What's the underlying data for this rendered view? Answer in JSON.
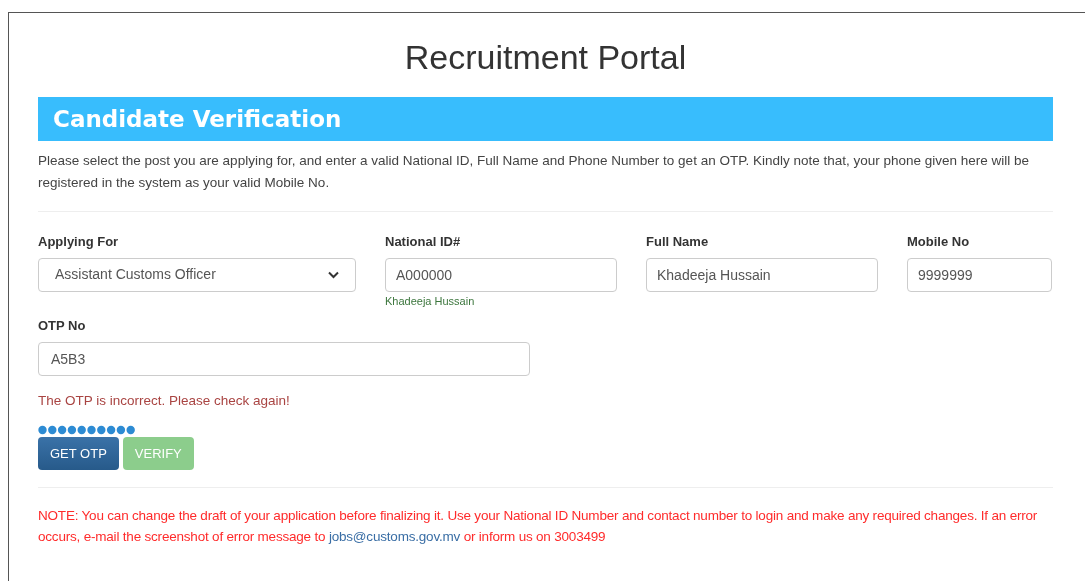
{
  "title": "Recruitment Portal",
  "section": {
    "heading": "Candidate Verification",
    "intro": "Please select the post you are applying for, and enter a valid National ID, Full Name and Phone Number to get an OTP. Kindly note that, your phone given here will be registered in the system as your valid Mobile No."
  },
  "fields": [
    {
      "kind": "select",
      "label": "Applying For",
      "value": "Assistant Customs Officer"
    },
    {
      "kind": "text",
      "label": "National ID#",
      "value": "A000000",
      "hint": "Khadeeja Hussain"
    },
    {
      "kind": "text",
      "label": "Full Name",
      "value": "Khadeeja Hussain"
    },
    {
      "kind": "text",
      "label": "Mobile No",
      "value": "9999999"
    }
  ],
  "otp": {
    "label": "OTP No",
    "value": "A5B3"
  },
  "error": "The OTP is incorrect. Please check again!",
  "buttons": [
    {
      "kind": "primary",
      "label": "GET OTP",
      "disabled": false
    },
    {
      "kind": "success",
      "label": "VERIFY",
      "disabled": true
    }
  ],
  "note": {
    "before": "NOTE: You can change the draft of your application before finalizing it. Use your National ID Number and contact number to login and make any required changes. If an error occurs, e-mail the screenshot of error message to ",
    "link": "jobs@customs.gov.mv",
    "after": " or inform us on 3003499"
  }
}
